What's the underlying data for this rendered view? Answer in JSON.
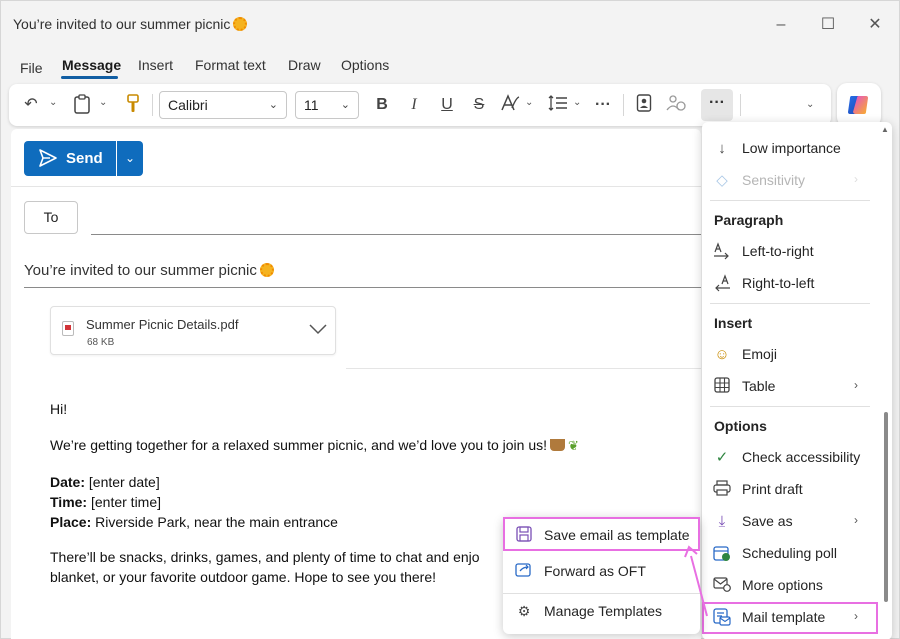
{
  "window": {
    "title": "You’re invited to our summer picnic",
    "controls": {
      "minimize": "–",
      "maximize": "☐",
      "close": "✕"
    }
  },
  "menubar": {
    "items": [
      "File",
      "Message",
      "Insert",
      "Format text",
      "Draw",
      "Options"
    ],
    "active": "Message"
  },
  "ribbon": {
    "font_family": "Calibri",
    "font_size": "11",
    "bold": "B",
    "italic": "I",
    "underline": "U",
    "strike": "S",
    "more": "···"
  },
  "compose": {
    "send_label": "Send",
    "to_label": "To",
    "subject": "You’re invited to our summer picnic",
    "attachment": {
      "name": "Summer Picnic Details.pdf",
      "size": "68 KB"
    },
    "body": {
      "greeting": "Hi!",
      "intro": "We’re getting together for a relaxed summer picnic, and we’d love you to join us!",
      "date_label": "Date:",
      "date_value": " [enter date]",
      "time_label": "Time:",
      "time_value": " [enter time]",
      "place_label": "Place:",
      "place_value": " Riverside Park, near the main entrance",
      "closing_line1": "There’ll be snacks, drinks, games, and plenty of time to chat and enjo",
      "closing_line2": "blanket, or your favorite outdoor game. Hope to see you there!"
    }
  },
  "side_menu": {
    "items": {
      "low_importance": "Low importance",
      "sensitivity": "Sensitivity",
      "left_to_right": "Left-to-right",
      "right_to_left": "Right-to-left",
      "emoji": "Emoji",
      "table": "Table",
      "check_accessibility": "Check accessibility",
      "print_draft": "Print draft",
      "save_as": "Save as",
      "scheduling_poll": "Scheduling poll",
      "more_options": "More options",
      "mail_template": "Mail template"
    },
    "headings": {
      "paragraph": "Paragraph",
      "insert": "Insert",
      "options": "Options"
    }
  },
  "sub_menu": {
    "items": [
      "Save email as template",
      "Forward as OFT",
      "Manage Templates"
    ]
  },
  "colors": {
    "accent": "#0f6cbd",
    "highlight": "#e86fe2"
  }
}
